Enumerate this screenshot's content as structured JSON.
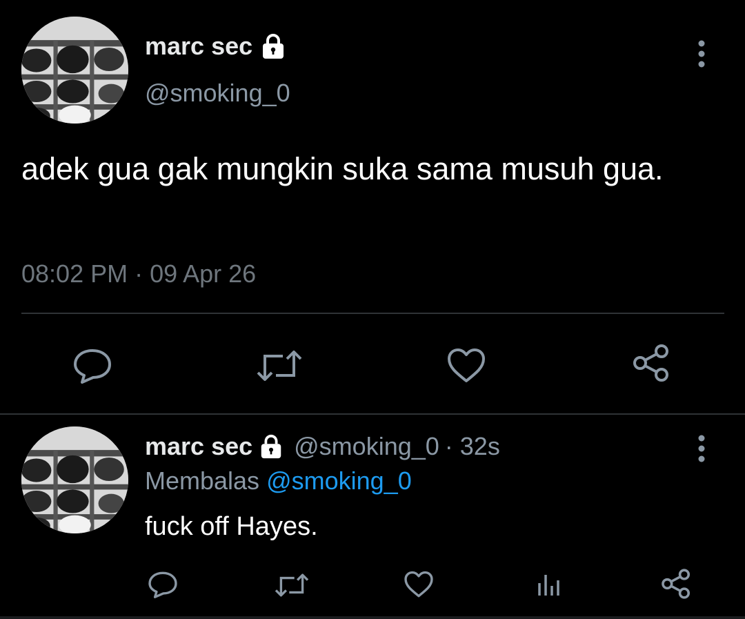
{
  "tweet": {
    "author_name": "marc sec",
    "author_handle": "@smoking_0",
    "text": "adek gua gak mungkin suka sama musuh gua.",
    "timestamp": "08:02 PM · 09 Apr 26",
    "icons": [
      "lock-icon",
      "more-icon",
      "reply-icon",
      "retweet-icon",
      "like-icon",
      "share-icon"
    ]
  },
  "reply": {
    "author_name": "marc sec",
    "author_handle": "@smoking_0",
    "age": "· 32s",
    "replying_label": "Membalas",
    "replying_to": "@smoking_0",
    "text": "fuck off Hayes.",
    "icons": [
      "lock-icon",
      "more-icon",
      "reply-icon",
      "retweet-icon",
      "like-icon",
      "analytics-icon",
      "share-icon"
    ]
  },
  "colors": {
    "background": "#000000",
    "text_primary": "#e7e9ea",
    "text_secondary": "#8b98a5",
    "accent": "#1d9bf0",
    "divider": "#2f3336"
  }
}
